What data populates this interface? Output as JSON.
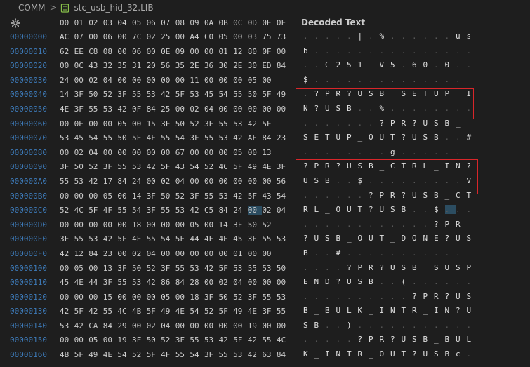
{
  "breadcrumb": {
    "root": "COMM",
    "separator": ">",
    "file": "stc_usb_hid_32.LIB",
    "file_icon": "library-file-icon"
  },
  "header": {
    "settings_icon": "gear-icon",
    "offsets": [
      "00",
      "01",
      "02",
      "03",
      "04",
      "05",
      "06",
      "07",
      "08",
      "09",
      "0A",
      "0B",
      "0C",
      "0D",
      "0E",
      "0F"
    ],
    "decoded_label": "Decoded Text"
  },
  "colors": {
    "address": "#3d7ab8",
    "highlight_box": "#d9262a",
    "selection": "#2c4d61"
  },
  "rows": [
    {
      "addr": "00000000",
      "hex": [
        "AC",
        "07",
        "00",
        "06",
        "00",
        "7C",
        "02",
        "25",
        "00",
        "A4",
        "C0",
        "05",
        "00",
        "03",
        "75",
        "73"
      ],
      "text": [
        ".",
        ".",
        ".",
        ".",
        ".",
        "|",
        ".",
        "%",
        ".",
        ".",
        ".",
        ".",
        ".",
        ".",
        "u",
        "s"
      ]
    },
    {
      "addr": "00000010",
      "hex": [
        "62",
        "EE",
        "C8",
        "08",
        "00",
        "06",
        "00",
        "0E",
        "09",
        "00",
        "00",
        "01",
        "12",
        "80",
        "0F",
        "00"
      ],
      "text": [
        "b",
        ".",
        ".",
        ".",
        ".",
        ".",
        ".",
        ".",
        ".",
        ".",
        ".",
        ".",
        ".",
        ".",
        ".",
        "."
      ]
    },
    {
      "addr": "00000020",
      "hex": [
        "00",
        "0C",
        "43",
        "32",
        "35",
        "31",
        "20",
        "56",
        "35",
        "2E",
        "36",
        "30",
        "2E",
        "30",
        "ED",
        "84"
      ],
      "text": [
        ".",
        ".",
        "C",
        "2",
        "5",
        "1",
        " ",
        "V",
        "5",
        ".",
        "6",
        "0",
        ".",
        "0",
        ".",
        "."
      ]
    },
    {
      "addr": "00000030",
      "hex": [
        "24",
        "00",
        "02",
        "04",
        "00",
        "00",
        "00",
        "00",
        "00",
        "11",
        "00",
        "00",
        "00",
        "05",
        "00"
      ],
      "text": [
        "$",
        ".",
        ".",
        ".",
        ".",
        ".",
        ".",
        ".",
        ".",
        ".",
        ".",
        ".",
        ".",
        ".",
        "."
      ]
    },
    {
      "addr": "00000040",
      "hex": [
        "14",
        "3F",
        "50",
        "52",
        "3F",
        "55",
        "53",
        "42",
        "5F",
        "53",
        "45",
        "54",
        "55",
        "50",
        "5F",
        "49"
      ],
      "text": [
        ".",
        "?",
        "P",
        "R",
        "?",
        "U",
        "S",
        "B",
        "_",
        "S",
        "E",
        "T",
        "U",
        "P",
        "_",
        "I"
      ]
    },
    {
      "addr": "00000050",
      "hex": [
        "4E",
        "3F",
        "55",
        "53",
        "42",
        "0F",
        "84",
        "25",
        "00",
        "02",
        "04",
        "00",
        "00",
        "00",
        "00",
        "00"
      ],
      "text": [
        "N",
        "?",
        "U",
        "S",
        "B",
        ".",
        ".",
        "%",
        ".",
        ".",
        ".",
        ".",
        ".",
        ".",
        ".",
        "."
      ]
    },
    {
      "addr": "00000060",
      "hex": [
        "00",
        "0E",
        "00",
        "00",
        "05",
        "00",
        "15",
        "3F",
        "50",
        "52",
        "3F",
        "55",
        "53",
        "42",
        "5F"
      ],
      "text": [
        ".",
        ".",
        ".",
        ".",
        ".",
        ".",
        ".",
        "?",
        "P",
        "R",
        "?",
        "U",
        "S",
        "B",
        "_"
      ]
    },
    {
      "addr": "00000070",
      "hex": [
        "53",
        "45",
        "54",
        "55",
        "50",
        "5F",
        "4F",
        "55",
        "54",
        "3F",
        "55",
        "53",
        "42",
        "AF",
        "84",
        "23"
      ],
      "text": [
        "S",
        "E",
        "T",
        "U",
        "P",
        "_",
        "O",
        "U",
        "T",
        "?",
        "U",
        "S",
        "B",
        ".",
        ".",
        "#"
      ]
    },
    {
      "addr": "00000080",
      "hex": [
        "00",
        "02",
        "04",
        "00",
        "00",
        "00",
        "00",
        "00",
        "67",
        "00",
        "00",
        "00",
        "05",
        "00",
        "13"
      ],
      "text": [
        ".",
        ".",
        ".",
        ".",
        ".",
        ".",
        ".",
        ".",
        "g",
        ".",
        ".",
        ".",
        ".",
        ".",
        "."
      ]
    },
    {
      "addr": "00000090",
      "hex": [
        "3F",
        "50",
        "52",
        "3F",
        "55",
        "53",
        "42",
        "5F",
        "43",
        "54",
        "52",
        "4C",
        "5F",
        "49",
        "4E",
        "3F"
      ],
      "text": [
        "?",
        "P",
        "R",
        "?",
        "U",
        "S",
        "B",
        "_",
        "C",
        "T",
        "R",
        "L",
        "_",
        "I",
        "N",
        "?"
      ]
    },
    {
      "addr": "000000A0",
      "hex": [
        "55",
        "53",
        "42",
        "17",
        "84",
        "24",
        "00",
        "02",
        "04",
        "00",
        "00",
        "00",
        "00",
        "00",
        "00",
        "56"
      ],
      "text": [
        "U",
        "S",
        "B",
        ".",
        ".",
        "$",
        ".",
        ".",
        ".",
        ".",
        ".",
        ".",
        ".",
        ".",
        ".",
        "V"
      ]
    },
    {
      "addr": "000000B0",
      "hex": [
        "00",
        "00",
        "00",
        "05",
        "00",
        "14",
        "3F",
        "50",
        "52",
        "3F",
        "55",
        "53",
        "42",
        "5F",
        "43",
        "54"
      ],
      "text": [
        ".",
        ".",
        ".",
        ".",
        ".",
        ".",
        "?",
        "P",
        "R",
        "?",
        "U",
        "S",
        "B",
        "_",
        "C",
        "T"
      ]
    },
    {
      "addr": "000000C0",
      "hex": [
        "52",
        "4C",
        "5F",
        "4F",
        "55",
        "54",
        "3F",
        "55",
        "53",
        "42",
        "C5",
        "84",
        "24",
        "00",
        "02",
        "04"
      ],
      "text": [
        "R",
        "L",
        "_",
        "O",
        "U",
        "T",
        "?",
        "U",
        "S",
        "B",
        ".",
        ".",
        "$",
        ".",
        ".",
        "."
      ]
    },
    {
      "addr": "000000D0",
      "hex": [
        "00",
        "00",
        "00",
        "00",
        "00",
        "18",
        "00",
        "00",
        "00",
        "05",
        "00",
        "14",
        "3F",
        "50",
        "52"
      ],
      "text": [
        ".",
        ".",
        ".",
        ".",
        ".",
        ".",
        ".",
        ".",
        ".",
        ".",
        ".",
        ".",
        "?",
        "P",
        "R"
      ]
    },
    {
      "addr": "000000E0",
      "hex": [
        "3F",
        "55",
        "53",
        "42",
        "5F",
        "4F",
        "55",
        "54",
        "5F",
        "44",
        "4F",
        "4E",
        "45",
        "3F",
        "55",
        "53"
      ],
      "text": [
        "?",
        "U",
        "S",
        "B",
        "_",
        "O",
        "U",
        "T",
        "_",
        "D",
        "O",
        "N",
        "E",
        "?",
        "U",
        "S"
      ]
    },
    {
      "addr": "000000F0",
      "hex": [
        "42",
        "12",
        "84",
        "23",
        "00",
        "02",
        "04",
        "00",
        "00",
        "00",
        "00",
        "00",
        "01",
        "00",
        "00"
      ],
      "text": [
        "B",
        ".",
        ".",
        "#",
        ".",
        ".",
        ".",
        ".",
        ".",
        ".",
        ".",
        ".",
        ".",
        ".",
        "."
      ]
    },
    {
      "addr": "00000100",
      "hex": [
        "00",
        "05",
        "00",
        "13",
        "3F",
        "50",
        "52",
        "3F",
        "55",
        "53",
        "42",
        "5F",
        "53",
        "55",
        "53",
        "50"
      ],
      "text": [
        ".",
        ".",
        ".",
        ".",
        "?",
        "P",
        "R",
        "?",
        "U",
        "S",
        "B",
        "_",
        "S",
        "U",
        "S",
        "P"
      ]
    },
    {
      "addr": "00000110",
      "hex": [
        "45",
        "4E",
        "44",
        "3F",
        "55",
        "53",
        "42",
        "86",
        "84",
        "28",
        "00",
        "02",
        "04",
        "00",
        "00",
        "00"
      ],
      "text": [
        "E",
        "N",
        "D",
        "?",
        "U",
        "S",
        "B",
        ".",
        ".",
        "(",
        ".",
        ".",
        ".",
        ".",
        ".",
        "."
      ]
    },
    {
      "addr": "00000120",
      "hex": [
        "00",
        "00",
        "00",
        "15",
        "00",
        "00",
        "00",
        "05",
        "00",
        "18",
        "3F",
        "50",
        "52",
        "3F",
        "55",
        "53"
      ],
      "text": [
        ".",
        ".",
        ".",
        ".",
        ".",
        ".",
        ".",
        ".",
        ".",
        ".",
        "?",
        "P",
        "R",
        "?",
        "U",
        "S"
      ]
    },
    {
      "addr": "00000130",
      "hex": [
        "42",
        "5F",
        "42",
        "55",
        "4C",
        "4B",
        "5F",
        "49",
        "4E",
        "54",
        "52",
        "5F",
        "49",
        "4E",
        "3F",
        "55"
      ],
      "text": [
        "B",
        "_",
        "B",
        "U",
        "L",
        "K",
        "_",
        "I",
        "N",
        "T",
        "R",
        "_",
        "I",
        "N",
        "?",
        "U"
      ]
    },
    {
      "addr": "00000140",
      "hex": [
        "53",
        "42",
        "CA",
        "84",
        "29",
        "00",
        "02",
        "04",
        "00",
        "00",
        "00",
        "00",
        "00",
        "19",
        "00",
        "00"
      ],
      "text": [
        "S",
        "B",
        ".",
        ".",
        ")",
        ".",
        ".",
        ".",
        ".",
        ".",
        ".",
        ".",
        ".",
        ".",
        ".",
        "."
      ]
    },
    {
      "addr": "00000150",
      "hex": [
        "00",
        "00",
        "05",
        "00",
        "19",
        "3F",
        "50",
        "52",
        "3F",
        "55",
        "53",
        "42",
        "5F",
        "42",
        "55",
        "4C"
      ],
      "text": [
        ".",
        ".",
        ".",
        ".",
        ".",
        "?",
        "P",
        "R",
        "?",
        "U",
        "S",
        "B",
        "_",
        "B",
        "U",
        "L"
      ]
    },
    {
      "addr": "00000160",
      "hex": [
        "4B",
        "5F",
        "49",
        "4E",
        "54",
        "52",
        "5F",
        "4F",
        "55",
        "54",
        "3F",
        "55",
        "53",
        "42",
        "63",
        "84"
      ],
      "text": [
        "K",
        "_",
        "I",
        "N",
        "T",
        "R",
        "_",
        "O",
        "U",
        "T",
        "?",
        "U",
        "S",
        "B",
        "c",
        "."
      ]
    }
  ]
}
